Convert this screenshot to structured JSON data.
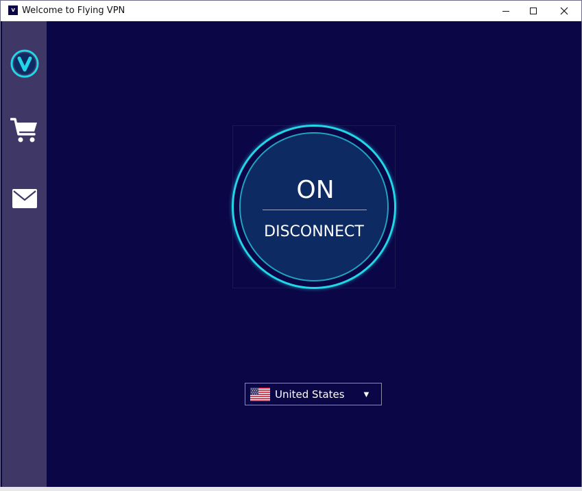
{
  "window": {
    "title": "Welcome to Flying VPN",
    "app_icon_text": "V"
  },
  "sidebar": {
    "items": [
      {
        "name": "logo",
        "icon": "v-logo-icon"
      },
      {
        "name": "store",
        "icon": "cart-icon"
      },
      {
        "name": "messages",
        "icon": "mail-icon"
      }
    ]
  },
  "connection": {
    "status": "ON",
    "action_label": "DISCONNECT"
  },
  "server": {
    "selected_country": "United States",
    "flag_icon": "us-flag-icon"
  },
  "colors": {
    "background": "#0b0646",
    "sidebar": "#3f3866",
    "ring_accent": "#22d6e8",
    "button_fill": "#0e2a63"
  }
}
